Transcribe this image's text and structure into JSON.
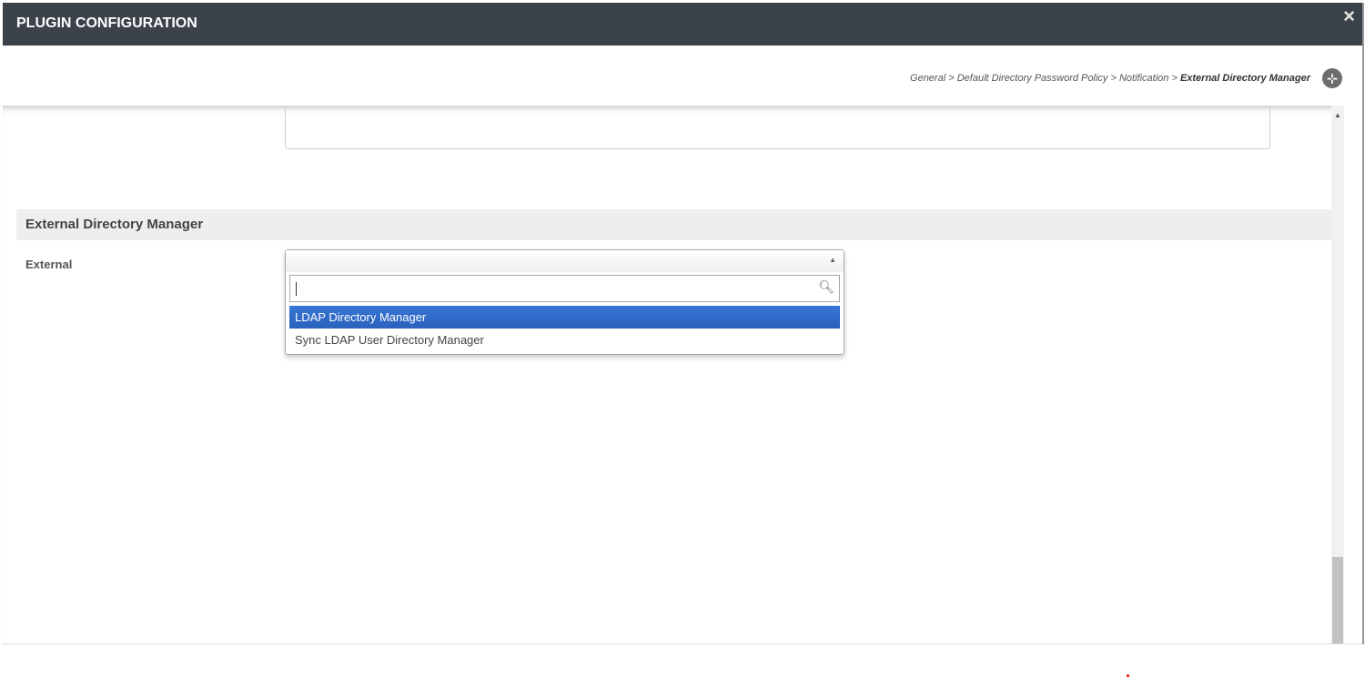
{
  "header": {
    "title": "PLUGIN CONFIGURATION",
    "close_icon": "×"
  },
  "breadcrumb": {
    "items": [
      "General",
      "Default Directory Password Policy",
      "Notification"
    ],
    "current": "External Directory Manager",
    "separator": ">"
  },
  "section": {
    "title": "External Directory Manager"
  },
  "field": {
    "label": "External",
    "search_value": "",
    "options": [
      "LDAP Directory Manager",
      "Sync LDAP User Directory Manager"
    ],
    "highlighted": "LDAP Directory Manager"
  },
  "colors": {
    "header": "#3b424a",
    "highlight": "#3875d7"
  }
}
